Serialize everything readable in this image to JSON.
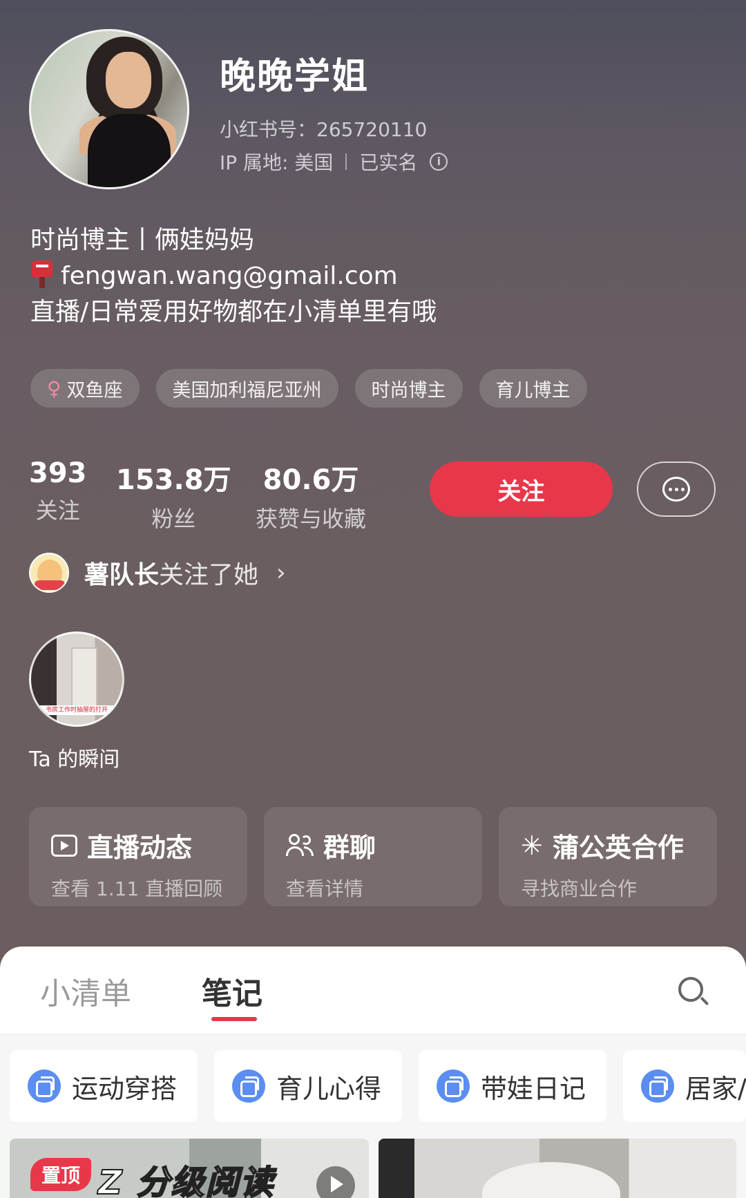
{
  "profile": {
    "name": "晚晚学姐",
    "red_id": "小红书号：265720110",
    "ip": "IP 属地: 美国",
    "verified": "已实名"
  },
  "bio": {
    "line1": "时尚博主丨俩娃妈妈",
    "email": "fengwan.wang@gmail.com",
    "line3": "直播/日常爱用好物都在小清单里有哦"
  },
  "tags": [
    "双鱼座",
    "美国加利福尼亚州",
    "时尚博主",
    "育儿博主"
  ],
  "stats": {
    "following": {
      "num": "393",
      "label": "关注"
    },
    "fans": {
      "num": "153.8万",
      "label": "粉丝"
    },
    "likes": {
      "num": "80.6万",
      "label": "获赞与收藏"
    }
  },
  "actions": {
    "follow": "关注"
  },
  "followed_by": {
    "name": "薯队长",
    "text": "关注了她"
  },
  "moment": {
    "label": "Ta 的瞬间",
    "thumb_caption": "书房工作时抽屉的打开"
  },
  "cards": [
    {
      "title": "直播动态",
      "sub": "查看 1.11 直播回顾",
      "icon": "live-video-icon"
    },
    {
      "title": "群聊",
      "sub": "查看详情",
      "icon": "group-chat-icon"
    },
    {
      "title": "蒲公英合作",
      "sub": "寻找商业合作",
      "icon": "dandelion-icon"
    }
  ],
  "tabs": {
    "list": "小清单",
    "notes": "笔记"
  },
  "albums": [
    "运动穿搭",
    "育儿心得",
    "带娃日记",
    "居家/"
  ],
  "notes": [
    {
      "badge": "置顶",
      "title": "Z 分级阅读"
    }
  ],
  "colors": {
    "accent": "#e8374a",
    "album_icon": "#5b8ef0"
  }
}
